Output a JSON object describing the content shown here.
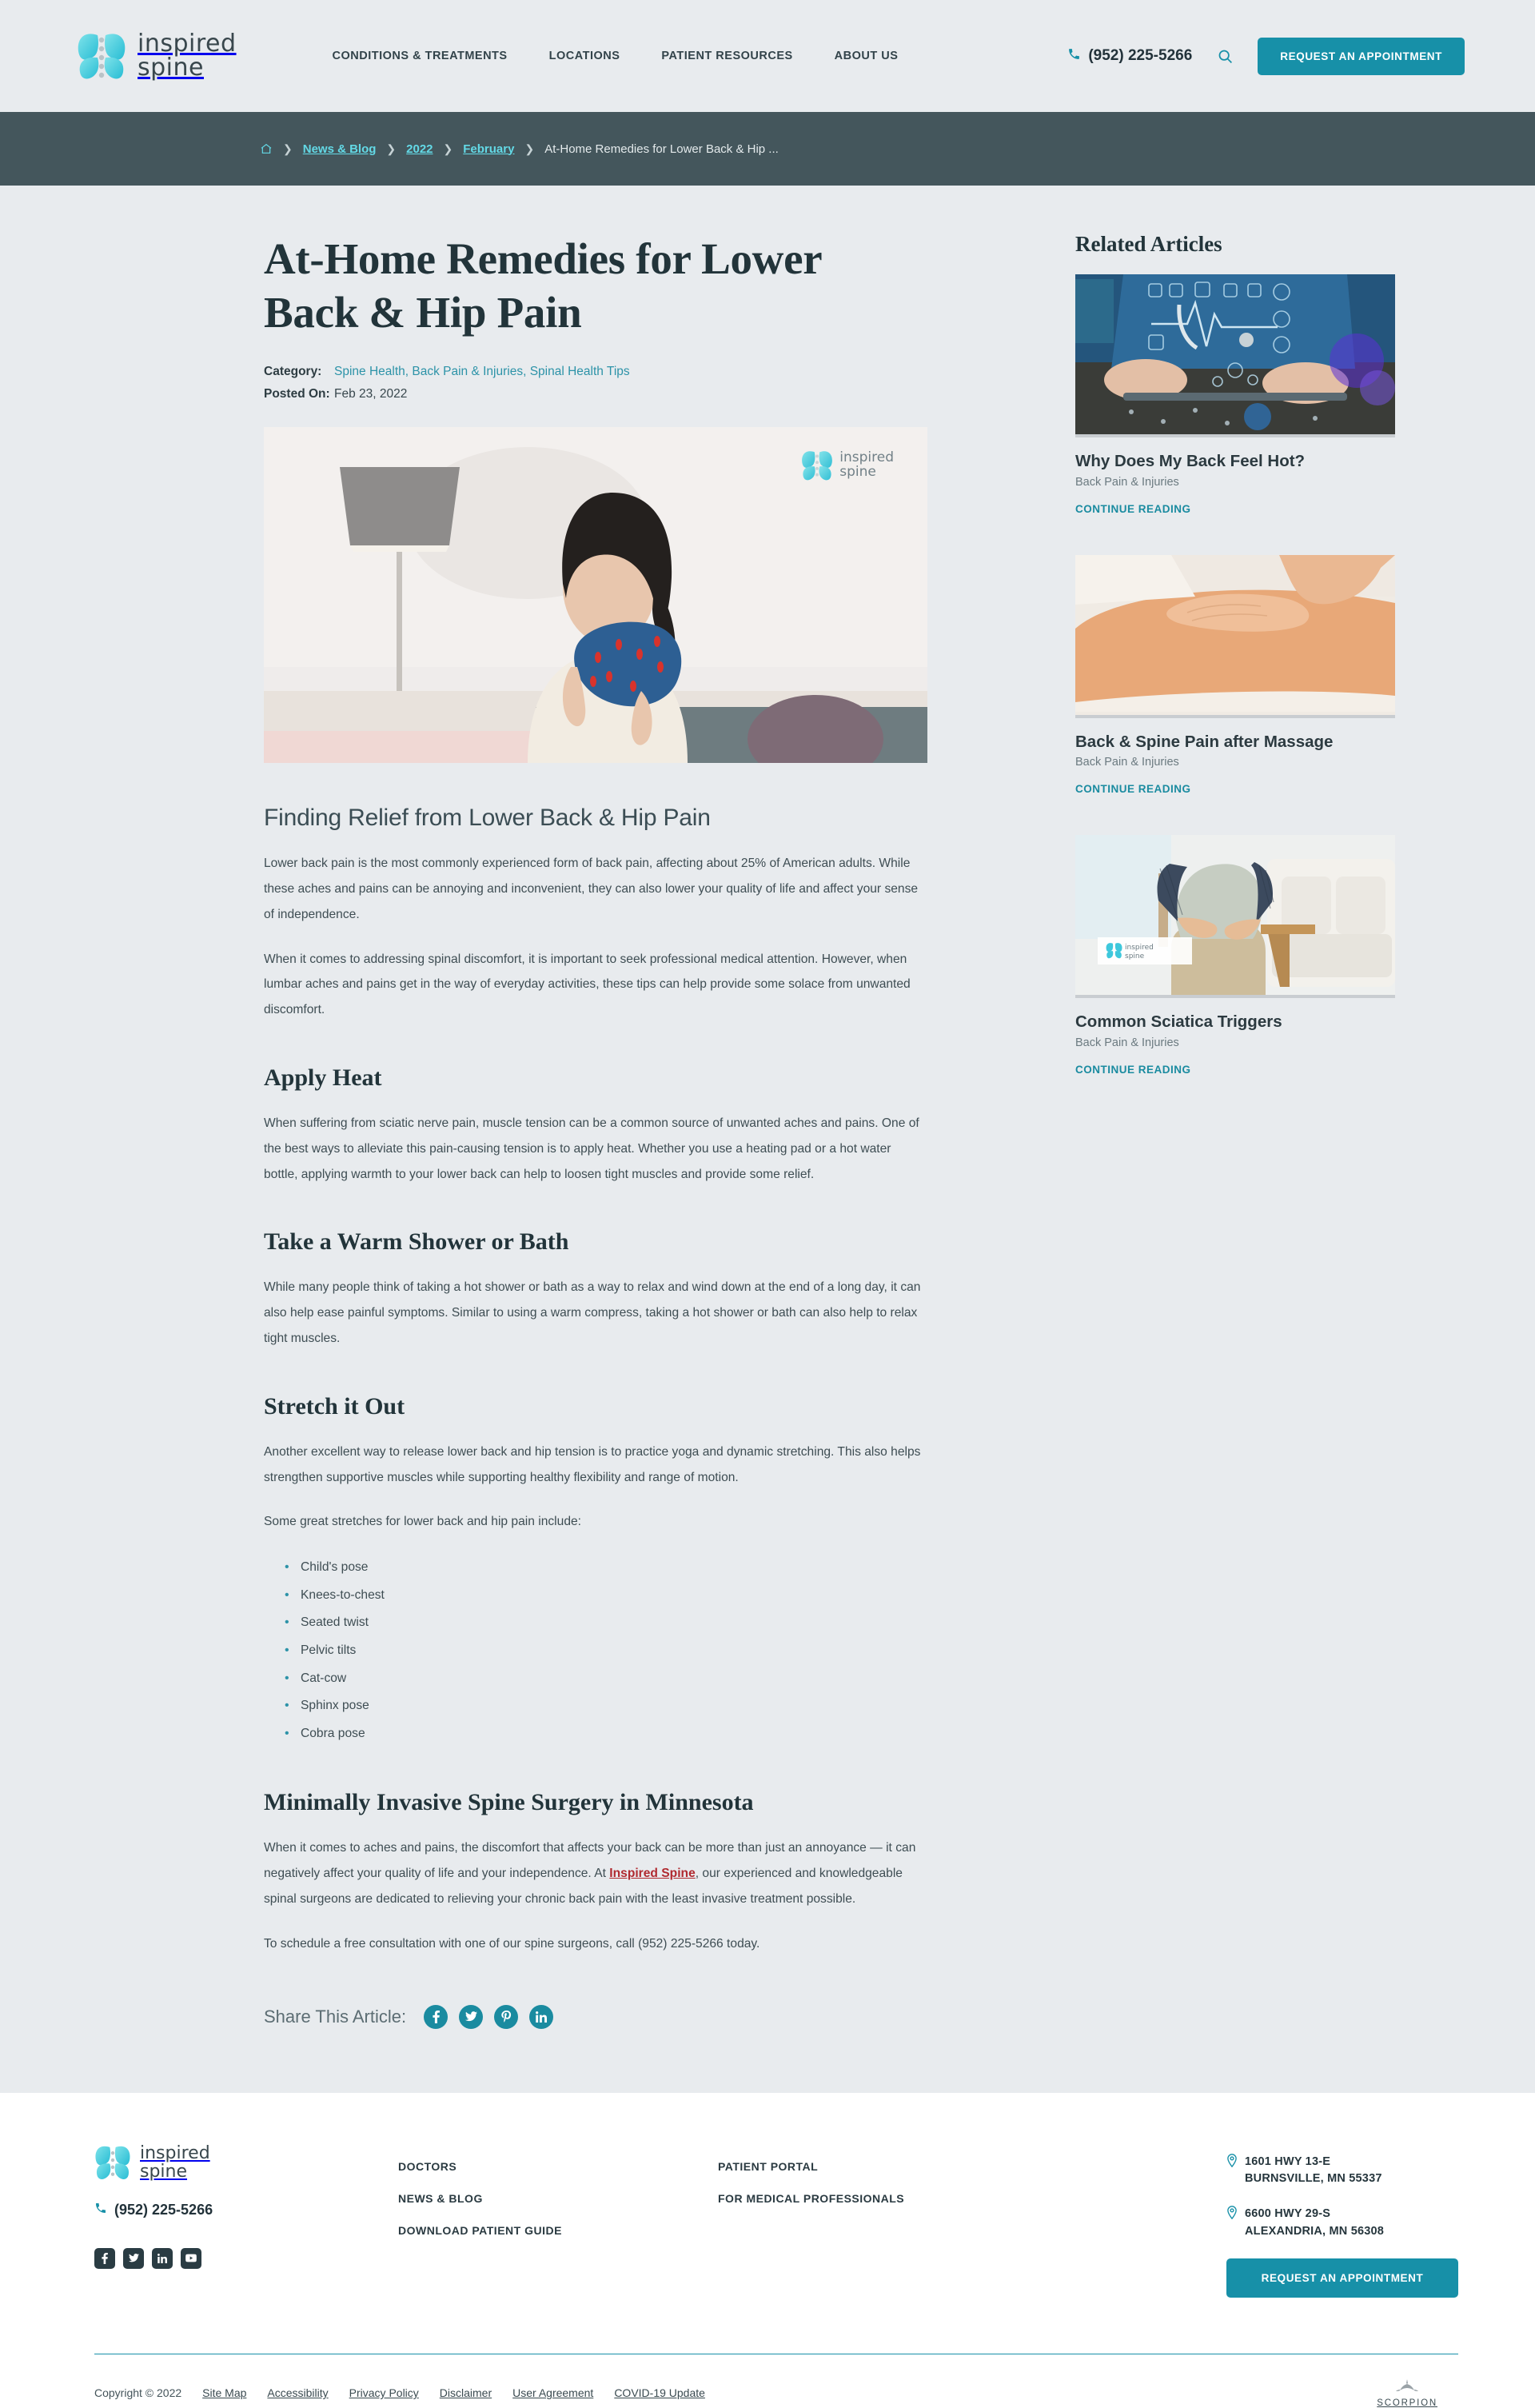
{
  "header": {
    "logo_line1": "inspired",
    "logo_line2": "spine",
    "nav": [
      {
        "label": "CONDITIONS & TREATMENTS"
      },
      {
        "label": "LOCATIONS"
      },
      {
        "label": "PATIENT RESOURCES"
      },
      {
        "label": "ABOUT US"
      }
    ],
    "phone": "(952) 225-5266",
    "cta_label": "REQUEST AN APPOINTMENT",
    "accent_color": "#1790a8"
  },
  "breadcrumb": {
    "bar_color": "#44565c",
    "link_color": "#63d9e6",
    "items": [
      {
        "label": "News & Blog",
        "link": true
      },
      {
        "label": "2022",
        "link": true
      },
      {
        "label": "February",
        "link": true
      },
      {
        "label": "At-Home Remedies for Lower Back & Hip ...",
        "link": false
      }
    ]
  },
  "article": {
    "title": "At-Home Remedies for Lower Back & Hip Pain",
    "category_label": "Category:",
    "categories": [
      "Spine Health,",
      "Back Pain & Injuries,",
      "Spinal Health Tips"
    ],
    "posted_label": "Posted On:",
    "posted_date": "Feb 23, 2022",
    "hero_caption": "Woman applying a heat wrap to her neck and shoulder while sitting on a couch",
    "hero_logo_line1": "inspired",
    "hero_logo_line2": "spine",
    "h2": "Finding Relief from Lower Back & Hip Pain",
    "p1": "Lower back pain is the most commonly experienced form of back pain, affecting about 25% of American adults. While these aches and pains can be annoying and inconvenient, they can also lower your quality of life and affect your sense of independence.",
    "p2": "When it comes to addressing spinal discomfort, it is important to seek professional medical attention. However, when lumbar aches and pains get in the way of everyday activities, these tips can help provide some solace from unwanted discomfort.",
    "h3_heat": "Apply Heat",
    "p_heat": "When suffering from sciatic nerve pain, muscle tension can be a common source of unwanted aches and pains. One of the best ways to alleviate this pain-causing tension is to apply heat. Whether you use a heating pad or a hot water bottle, applying warmth to your lower back can help to loosen tight muscles and provide some relief.",
    "h3_shower": "Take a Warm Shower or Bath",
    "p_shower": "While many people think of taking a hot shower or bath as a way to relax and wind down at the end of a long day, it can also help ease painful symptoms. Similar to using a warm compress, taking a hot shower or bath can also help to relax tight muscles.",
    "h3_stretch": "Stretch it Out",
    "p_stretch1": "Another excellent way to release lower back and hip tension is to practice yoga and dynamic stretching. This also helps strengthen supportive muscles while supporting healthy flexibility and range of motion.",
    "p_stretch2": "Some great stretches for lower back and hip pain include:",
    "stretches": [
      "Child's pose",
      "Knees-to-chest",
      "Seated twist",
      "Pelvic tilts",
      "Cat-cow",
      "Sphinx pose",
      "Cobra pose"
    ],
    "h3_surgery": "Minimally Invasive Spine Surgery in Minnesota",
    "p_surgery_a": "When it comes to aches and pains, the discomfort that affects your back can be more than just an annoyance — it can negatively affect your quality of life and your independence. At ",
    "p_surgery_link": "Inspired Spine",
    "p_surgery_b": ", our experienced and knowledgeable spinal surgeons are dedicated to relieving your chronic back pain with the least invasive treatment possible.",
    "p_schedule": "To schedule a free consultation with one of our spine surgeons, call (952) 225-5266 today.",
    "share_label": "Share This Article:",
    "share_links": [
      {
        "name": "facebook",
        "glyph": "f"
      },
      {
        "name": "twitter",
        "glyph": "ᵛ"
      },
      {
        "name": "pinterest",
        "glyph": "P"
      },
      {
        "name": "linkedin",
        "glyph": "in"
      }
    ]
  },
  "sidebar": {
    "heading": "Related Articles",
    "cards": [
      {
        "title": "Why Does My Back Feel Hot?",
        "category": "Back Pain & Injuries",
        "cta": "CONTINUE READING",
        "image_alt": "Doctor using a tablet with medical data overlay graphics"
      },
      {
        "title": "Back & Spine Pain after Massage",
        "category": "Back Pain & Injuries",
        "cta": "CONTINUE READING",
        "image_alt": "Hands massaging a person's bare back"
      },
      {
        "title": "Common Sciatica Triggers",
        "category": "Back Pain & Injuries",
        "cta": "CONTINUE READING",
        "image_alt": "Man standing and holding his lower back in pain near a sofa"
      }
    ]
  },
  "footer": {
    "logo_line1": "inspired",
    "logo_line2": "spine",
    "phone": "(952) 225-5266",
    "social": [
      {
        "name": "facebook",
        "glyph": "f"
      },
      {
        "name": "twitter",
        "glyph": "ᵛ"
      },
      {
        "name": "linkedin",
        "glyph": "in"
      },
      {
        "name": "youtube",
        "glyph": "▶"
      }
    ],
    "links_col1": [
      {
        "label": "DOCTORS"
      },
      {
        "label": "NEWS & BLOG"
      },
      {
        "label": "DOWNLOAD PATIENT GUIDE"
      }
    ],
    "links_col2": [
      {
        "label": "PATIENT PORTAL"
      },
      {
        "label": "FOR MEDICAL PROFESSIONALS"
      }
    ],
    "addresses": [
      {
        "line1": "1601 HWY 13-E",
        "line2": "BURNSVILLE, MN 55337"
      },
      {
        "line1": "6600 HWY 29-S",
        "line2": "ALEXANDRIA, MN 56308"
      }
    ],
    "cta_label": "REQUEST AN APPOINTMENT",
    "copyright": "Copyright © 2022",
    "legal_links": [
      {
        "label": "Site Map"
      },
      {
        "label": "Accessibility"
      },
      {
        "label": "Privacy Policy"
      },
      {
        "label": "Disclaimer"
      },
      {
        "label": "User Agreement"
      },
      {
        "label": "COVID-19 Update"
      }
    ],
    "agency_name": "SCORPION"
  }
}
